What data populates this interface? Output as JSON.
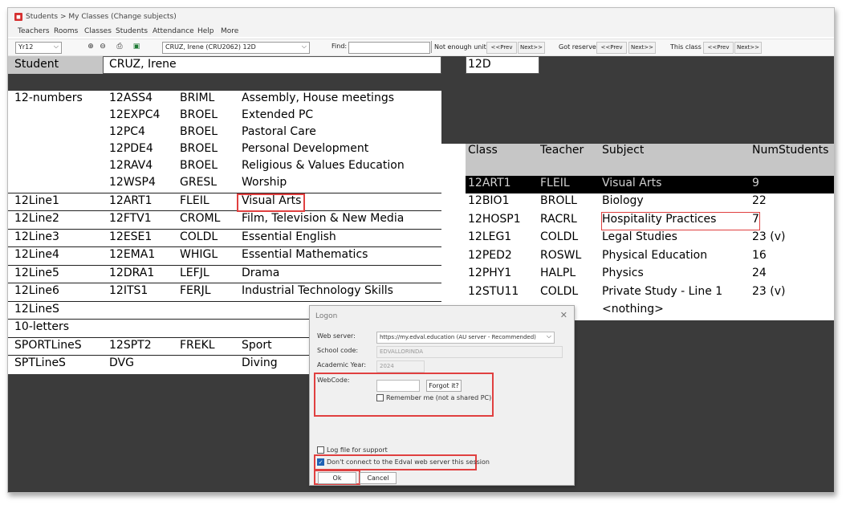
{
  "titlebar": {
    "title": "Students > My Classes (Change subjects)"
  },
  "menu": [
    "Teachers",
    "Rooms",
    "Classes",
    "Students",
    "Attendance",
    "Help",
    "More"
  ],
  "toolbar": {
    "year_select": "Yr12",
    "student_select": "CRUZ, Irene (CRU2062) 12D",
    "find_label": "Find:",
    "not_enough_units": "Not enough units",
    "got_reserve": "Got reserve",
    "this_class": "This class",
    "prev": "<<Prev",
    "next": "Next>>"
  },
  "student": {
    "label": "Student",
    "name": "CRUZ, Irene",
    "rollclass": "12D"
  },
  "enrolments": [
    {
      "line": "12-numbers",
      "code": "12ASS4",
      "teacher": "BRIML",
      "subject": "Assembly, House meetings"
    },
    {
      "line": "",
      "code": "12EXPC4",
      "teacher": "BROEL",
      "subject": "Extended PC"
    },
    {
      "line": "",
      "code": "12PC4",
      "teacher": "BROEL",
      "subject": "Pastoral Care"
    },
    {
      "line": "",
      "code": "12PDE4",
      "teacher": "BROEL",
      "subject": "Personal Development"
    },
    {
      "line": "",
      "code": "12RAV4",
      "teacher": "BROEL",
      "subject": "Religious & Values Education"
    },
    {
      "line": "",
      "code": "12WSP4",
      "teacher": "GRESL",
      "subject": "Worship"
    },
    {
      "line": "12Line1",
      "code": "12ART1",
      "teacher": "FLEIL",
      "subject": "Visual Arts"
    },
    {
      "line": "12Line2",
      "code": "12FTV1",
      "teacher": "CROML",
      "subject": "Film, Television & New Media"
    },
    {
      "line": "12Line3",
      "code": "12ESE1",
      "teacher": "COLDL",
      "subject": "Essential English"
    },
    {
      "line": "12Line4",
      "code": "12EMA1",
      "teacher": "WHIGL",
      "subject": "Essential Mathematics"
    },
    {
      "line": "12Line5",
      "code": "12DRA1",
      "teacher": "LEFJL",
      "subject": "Drama"
    },
    {
      "line": "12Line6",
      "code": "12ITS1",
      "teacher": "FERJL",
      "subject": "Industrial Technology Skills"
    },
    {
      "line": "12LineS",
      "code": "",
      "teacher": "",
      "subject": ""
    },
    {
      "line": "10-letters",
      "code": "",
      "teacher": "",
      "subject": ""
    },
    {
      "line": "SPORTLineS",
      "code": "12SPT2",
      "teacher": "FREKL",
      "subject": "Sport"
    },
    {
      "line": "SPTLineS",
      "code": "DVG",
      "teacher": "",
      "subject": "Diving"
    }
  ],
  "class_table": {
    "headers": [
      "Class",
      "Teacher",
      "Subject",
      "NumStudents"
    ],
    "rows": [
      {
        "class": "12ART1",
        "teacher": "FLEIL",
        "subject": "Visual Arts",
        "num": "9"
      },
      {
        "class": "12BIO1",
        "teacher": "BROLL",
        "subject": "Biology",
        "num": "22"
      },
      {
        "class": "12HOSP1",
        "teacher": "RACRL",
        "subject": "Hospitality Practices",
        "num": "7"
      },
      {
        "class": "12LEG1",
        "teacher": "COLDL",
        "subject": "Legal Studies",
        "num": "23 (v)"
      },
      {
        "class": "12PED2",
        "teacher": "ROSWL",
        "subject": "Physical Education",
        "num": "16"
      },
      {
        "class": "12PHY1",
        "teacher": "HALPL",
        "subject": "Physics",
        "num": "24"
      },
      {
        "class": "12STU11",
        "teacher": "COLDL",
        "subject": "Private Study - Line 1",
        "num": "23 (v)"
      },
      {
        "class": "",
        "teacher": "",
        "subject": "<nothing>",
        "num": ""
      }
    ]
  },
  "logon": {
    "title": "Logon",
    "web_server_label": "Web server:",
    "web_server_value": "https://my.edval.education (AU server - Recommended)",
    "school_code_label": "School code:",
    "school_code_value": "EDVALLORINDA",
    "academic_year_label": "Academic Year:",
    "academic_year_value": "2024",
    "webcode_label": "WebCode:",
    "forgot_button": "Forgot it?",
    "remember_label": "Remember me (not a shared PC)",
    "log_file_label": "Log file for support",
    "dont_connect_label": "Don't connect to the Edval web server this session",
    "ok_button": "Ok",
    "cancel_button": "Cancel"
  },
  "colors": {
    "dark_bg": "#3b3b3b",
    "header_gray": "#c6c6c6",
    "highlight_red": "#e04040",
    "selected_row": "#000000"
  }
}
